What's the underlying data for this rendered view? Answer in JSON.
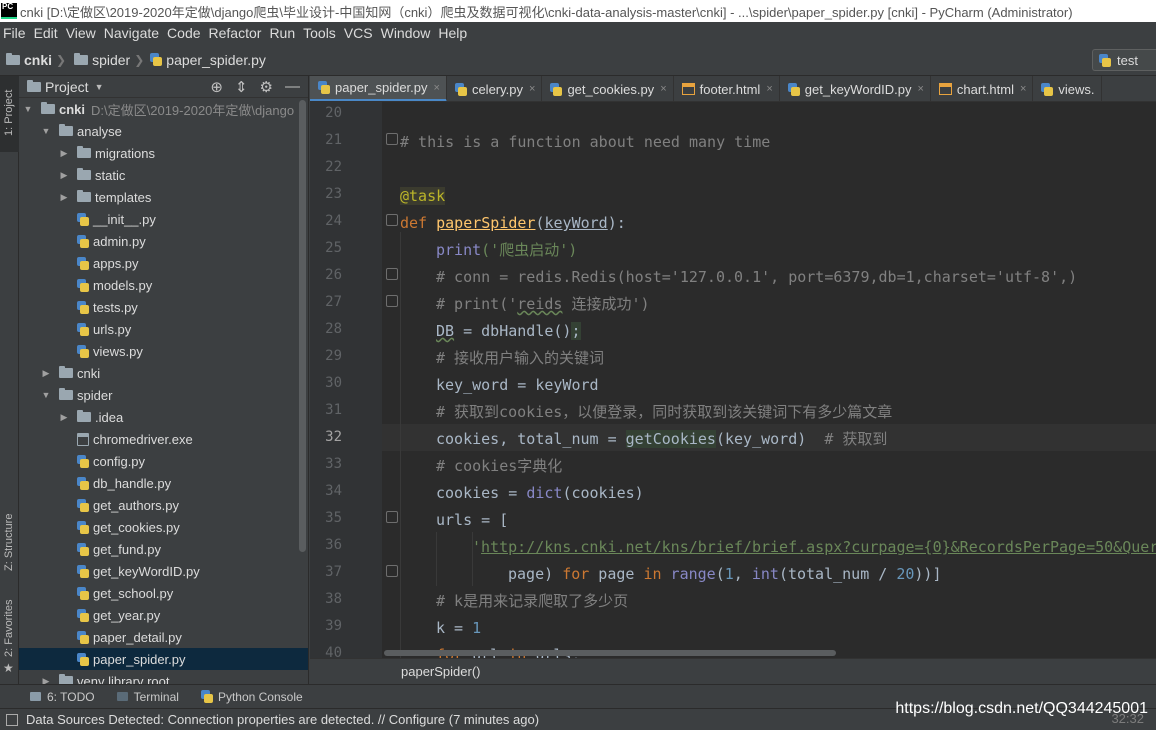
{
  "window": {
    "title": "cnki [D:\\定做区\\2019-2020年定做\\django爬虫\\毕业设计-中国知网（cnki）爬虫及数据可视化\\cnki-data-analysis-master\\cnki] - ...\\spider\\paper_spider.py [cnki] - PyCharm (Administrator)",
    "logo": "PC"
  },
  "menu": [
    "File",
    "Edit",
    "View",
    "Navigate",
    "Code",
    "Refactor",
    "Run",
    "Tools",
    "VCS",
    "Window",
    "Help"
  ],
  "breadcrumb": [
    "cnki",
    "spider",
    "paper_spider.py"
  ],
  "run_config": "test",
  "left_strip": {
    "project": "1: Project",
    "structure": "Z: Structure",
    "favorites": "2: Favorites"
  },
  "project": {
    "title": "Project",
    "tree": [
      {
        "label": "cnki",
        "note": "D:\\定做区\\2019-2020年定做\\django",
        "type": "folder",
        "level": 0,
        "arrow": "▼"
      },
      {
        "label": "analyse",
        "type": "folder",
        "level": 1,
        "arrow": "▼"
      },
      {
        "label": "migrations",
        "type": "folder",
        "level": 2,
        "arrow": "▶"
      },
      {
        "label": "static",
        "type": "folder",
        "level": 2,
        "arrow": "▶"
      },
      {
        "label": "templates",
        "type": "folder",
        "level": 2,
        "arrow": "▶"
      },
      {
        "label": "__init__.py",
        "type": "py",
        "level": 2
      },
      {
        "label": "admin.py",
        "type": "py",
        "level": 2
      },
      {
        "label": "apps.py",
        "type": "py",
        "level": 2
      },
      {
        "label": "models.py",
        "type": "py",
        "level": 2
      },
      {
        "label": "tests.py",
        "type": "py",
        "level": 2
      },
      {
        "label": "urls.py",
        "type": "py",
        "level": 2
      },
      {
        "label": "views.py",
        "type": "py",
        "level": 2
      },
      {
        "label": "cnki",
        "type": "folder",
        "level": 1,
        "arrow": "▶"
      },
      {
        "label": "spider",
        "type": "folder",
        "level": 1,
        "arrow": "▼"
      },
      {
        "label": ".idea",
        "type": "folder",
        "level": 2,
        "arrow": "▶"
      },
      {
        "label": "chromedriver.exe",
        "type": "exe",
        "level": 2
      },
      {
        "label": "config.py",
        "type": "py",
        "level": 2
      },
      {
        "label": "db_handle.py",
        "type": "py",
        "level": 2
      },
      {
        "label": "get_authors.py",
        "type": "py",
        "level": 2
      },
      {
        "label": "get_cookies.py",
        "type": "py",
        "level": 2
      },
      {
        "label": "get_fund.py",
        "type": "py",
        "level": 2
      },
      {
        "label": "get_keyWordID.py",
        "type": "py",
        "level": 2
      },
      {
        "label": "get_school.py",
        "type": "py",
        "level": 2
      },
      {
        "label": "get_year.py",
        "type": "py",
        "level": 2
      },
      {
        "label": "paper_detail.py",
        "type": "py",
        "level": 2
      },
      {
        "label": "paper_spider.py",
        "type": "py",
        "level": 2,
        "selected": true
      },
      {
        "label": "venv  library root",
        "type": "folder",
        "level": 1,
        "arrow": "▶"
      }
    ]
  },
  "tabs": [
    {
      "label": "paper_spider.py",
      "type": "py",
      "active": true
    },
    {
      "label": "celery.py",
      "type": "py"
    },
    {
      "label": "get_cookies.py",
      "type": "py"
    },
    {
      "label": "footer.html",
      "type": "html"
    },
    {
      "label": "get_keyWordID.py",
      "type": "py"
    },
    {
      "label": "chart.html",
      "type": "html"
    },
    {
      "label": "views.",
      "type": "py"
    }
  ],
  "editor": {
    "line_numbers": [
      "20",
      "21",
      "22",
      "23",
      "24",
      "25",
      "26",
      "27",
      "28",
      "29",
      "30",
      "31",
      "32",
      "33",
      "34",
      "35",
      "36",
      "37",
      "38",
      "39",
      "40"
    ],
    "current_line": "32",
    "lines": {
      "l21": "# this is a function about need many time",
      "l23": "@task",
      "l24_kw": "def ",
      "l24_fn": "paperSpider",
      "l24_p1": "(",
      "l24_arg": "keyWord",
      "l24_p2": "):",
      "l25_fn": "print",
      "l25_str": "('爬虫启动')",
      "l26": "# conn = redis.Redis(host='127.0.0.1', port=6379,db=1,charset='utf-8',)",
      "l27a": "# print('",
      "l27b": "reids",
      "l27c": " 连接成功')",
      "l28a": "DB",
      "l28b": " = dbHandle()",
      "l28c": ";",
      "l29": "# 接收用户输入的关键词",
      "l30": "key_word = keyWord",
      "l31": "# 获取到cookies，以便登录，同时获取到该关键词下有多少篇文章",
      "l32a": "cookies, total_num = ",
      "l32b": "getCookies",
      "l32c": "(key_word)  ",
      "l32d": "# 获取到",
      "l33": "# cookies字典化",
      "l34a": "cookies = ",
      "l34b": "dict",
      "l34c": "(cookies)",
      "l35": "urls = [",
      "l36a": "'",
      "l36b": "http://kns.cnki.net/kns/brief/brief.aspx?curpage={0}&RecordsPerPage=50&QueryI",
      "l37a": "page) ",
      "l37b": "for",
      "l37c": " page ",
      "l37d": "in",
      "l37e": " range",
      "l37f": "(",
      "l37g": "1",
      "l37h": ", ",
      "l37i": "int",
      "l37j": "(total_num / ",
      "l37k": "20",
      "l37l": "))]",
      "l38": "# k是用来记录爬取了多少页",
      "l39a": "k = ",
      "l39b": "1",
      "l40a": "for",
      "l40b": " url ",
      "l40c": "in",
      "l40d": " urls:"
    },
    "breadcrumb_status": "paperSpider()"
  },
  "bottom_tabs": [
    "6: TODO",
    "Terminal",
    "Python Console"
  ],
  "status": {
    "message": "Data Sources Detected: Connection properties are detected. // Configure (7 minutes ago)",
    "watermark": "https://blog.csdn.net/QQ344245001",
    "cursor": "32:32"
  }
}
